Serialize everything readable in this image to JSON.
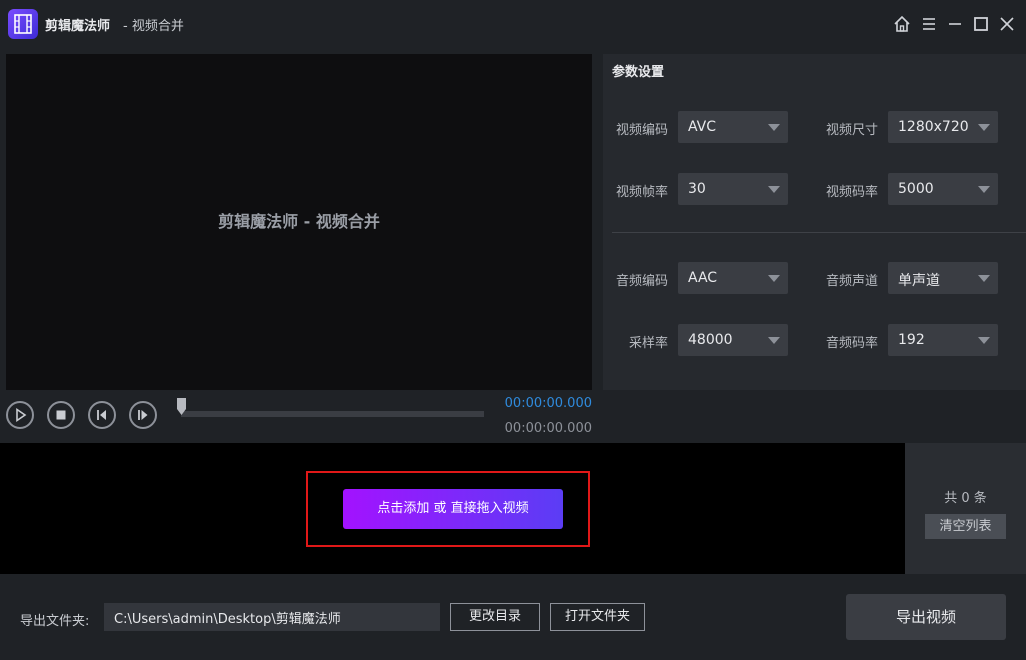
{
  "titlebar": {
    "app_name": "剪辑魔法师",
    "subtitle": "- 视频合并",
    "icons": [
      "film-logo-icon",
      "home-icon",
      "menu-icon",
      "minimize-icon",
      "maximize-icon",
      "close-icon"
    ]
  },
  "preview": {
    "title": "剪辑魔法师 - 视频合并"
  },
  "player": {
    "current_time": "00:00:00.000",
    "total_time": "00:00:00.000",
    "progress": 0,
    "icons": [
      "play-icon",
      "stop-icon",
      "prev-frame-icon",
      "next-frame-icon"
    ]
  },
  "settings": {
    "title": "参数设置",
    "video_codec": {
      "label": "视频编码",
      "value": "AVC"
    },
    "video_size": {
      "label": "视频尺寸",
      "value": "1280x720"
    },
    "video_fps": {
      "label": "视频帧率",
      "value": "30"
    },
    "video_bitrate": {
      "label": "视频码率",
      "value": "5000"
    },
    "audio_codec": {
      "label": "音频编码",
      "value": "AAC"
    },
    "audio_channel": {
      "label": "音频声道",
      "value": "单声道"
    },
    "sample_rate": {
      "label": "采样率",
      "value": "48000"
    },
    "audio_bitrate": {
      "label": "音频码率",
      "value": "192"
    }
  },
  "drop": {
    "add_label": "点击添加 或 直接拖入视频"
  },
  "list": {
    "count": "共 0 条",
    "clear_label": "清空列表"
  },
  "footer": {
    "export_label": "导出文件夹:",
    "path": "C:\\Users\\admin\\Desktop\\剪辑魔法师",
    "change_dir_label": "更改目录",
    "open_folder_label": "打开文件夹",
    "export_label_button": "导出视频"
  },
  "colors": {
    "accent_start": "#a312ff",
    "accent_end": "#5b3df5",
    "time_blue": "#2f8bdd",
    "highlight_red": "#e01818"
  }
}
